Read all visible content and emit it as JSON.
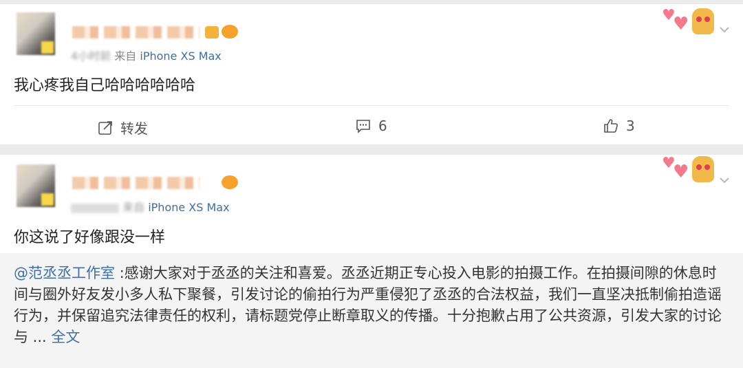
{
  "posts": [
    {
      "meta_time": "4小时前",
      "meta_from": "来自",
      "meta_device": "iPhone XS Max",
      "text": "我心疼我自己哈哈哈哈哈哈",
      "actions": {
        "repost_label": "转发",
        "comment_count": "6",
        "like_count": "3"
      }
    },
    {
      "meta_time": "来自",
      "meta_device": "iPhone XS Max",
      "text": "你这说了好像跟没一样",
      "quote": {
        "mention": "@范丞丞工作室",
        "body": " :感谢大家对于丞丞的关注和喜爱。丞丞近期正专心投入电影的拍摄工作。在拍摄间隙的休息时间与圈外好友发小多人私下聚餐，引发讨论的偷拍行为严重侵犯了丞丞的合法权益，我们一直坚决抵制偷拍造谣行为，并保留追究法律责任的权利，请标题党停止断章取义的传播。十分抱歉占用了公共资源，引发大家的讨论与 ... ",
        "more": "全文"
      }
    }
  ],
  "icons": {
    "repost": "repost-icon",
    "comment": "comment-icon",
    "like": "like-icon",
    "chevron": "chevron-down-icon"
  },
  "colors": {
    "link": "#3d6ea6",
    "background": "#ebebeb",
    "quote_bg": "#f4f4f4"
  }
}
